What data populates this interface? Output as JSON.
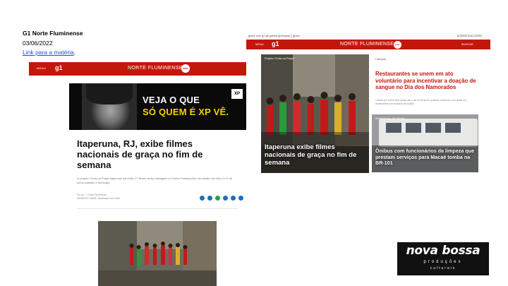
{
  "header": {
    "source": "G1 Norte Fluminense",
    "date": "03/06/2022",
    "link_text": "Link para a matéria",
    "link_suffix": "."
  },
  "article_page": {
    "nav": {
      "menu_label": "MENU",
      "logo": "g1",
      "region": "NORTE FLUMINENSE",
      "tv_badge": "inter"
    },
    "ad": {
      "line1": "VEJA O QUE",
      "line2": "SÓ QUEM É XP VÊ.",
      "brand": "XP"
    },
    "title": "Itaperuna, RJ, exibe filmes nacionais de graça no fim de semana",
    "subtitle": "O projeto 'Curta na Praça Itaperuna' vai exibir 17 filmes curta-metragem no Centro Poliesportivo da cidade nos dias 4 e 5 de junho (sábado e domingo).",
    "byline": "Por g1 — Norte Fluminense",
    "timestamp": "03/06/2022 18h48 · Atualizado há 2 dias",
    "share_icons": [
      "facebook-icon",
      "twitter-icon",
      "whatsapp-icon",
      "pinterest-icon",
      "telegram-icon",
      "linkedin-icon"
    ]
  },
  "home_page": {
    "top_links": "globo.com   g1   ge   gshow   globoplay   ξ globo",
    "user_label": "ACESSE SUA CONTA",
    "nav": {
      "menu_label": "MENU",
      "logo": "g1",
      "region": "NORTE FLUMINENSE",
      "tv_badge": "inter",
      "search_label": "BUSCAR"
    },
    "main_story": {
      "kicker": "Projeto 'Curta na Praça'",
      "headline": "Itaperuna exibe filmes nacionais de graça no fim de semana"
    },
    "story_2": {
      "kicker": "Campos",
      "headline": "Restaurantes se unem em ato voluntário para incentivar a doação de sangue no Dia dos Namorados",
      "body": "Casais que forem doar juntos até o dia 10 de junho poderão concorrer a um jantar em restaurantes conveniados da cidade."
    },
    "story_3": {
      "kicker": "Interbairrego de Macaé",
      "headline": "Ônibus com funcionários da limpeza que prestam serviços para Macaé tomba na BR-101"
    }
  },
  "logo": {
    "line1": "nova bossa",
    "line2": "produções",
    "line3": "culturais"
  },
  "colors": {
    "g1_red": "#c4170c",
    "ad_yellow": "#f6d000",
    "link_blue": "#1f4fd1"
  }
}
